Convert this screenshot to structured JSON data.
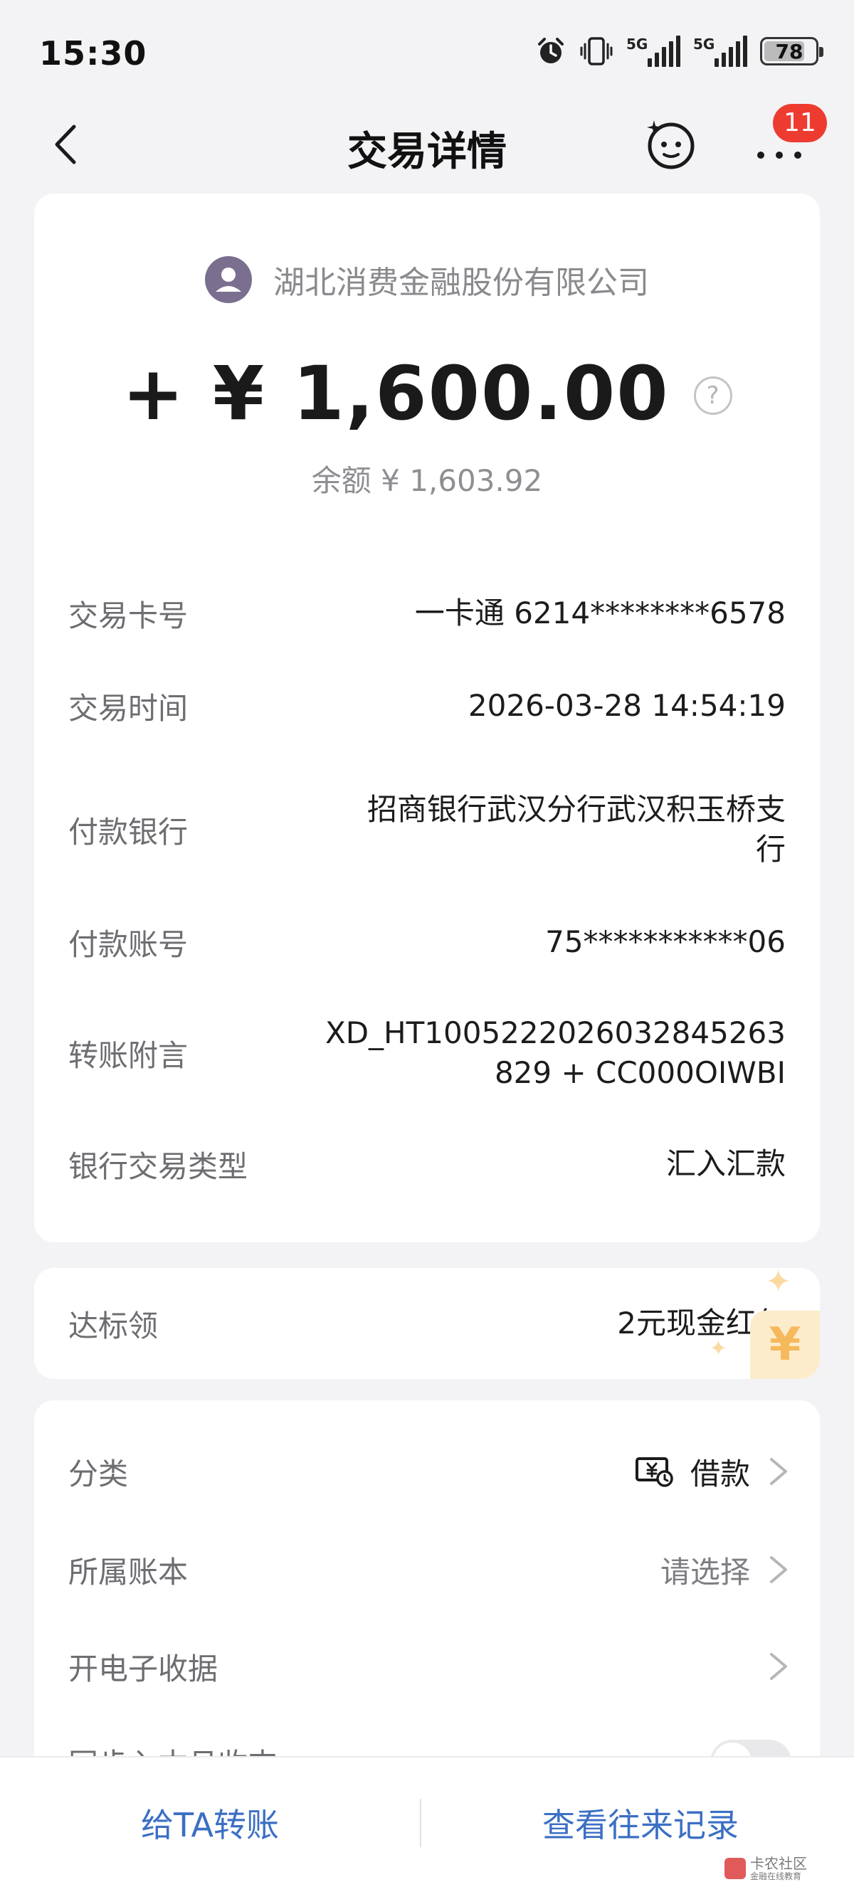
{
  "status_bar": {
    "time": "15:30",
    "network_1": "5G",
    "network_2": "5G",
    "battery": "78",
    "battery_level": 0.78
  },
  "header": {
    "title": "交易详情",
    "notification_count": "11"
  },
  "transaction": {
    "merchant": "湖北消费金融股份有限公司",
    "amount": "+ ¥ 1,600.00",
    "balance": "余额 ¥ 1,603.92",
    "details": [
      {
        "label": "交易卡号",
        "value": "一卡通 6214********6578"
      },
      {
        "label": "交易时间",
        "value": "2026-03-28 14:54:19"
      },
      {
        "label": "付款银行",
        "value_line1": "招商银行武汉分行武汉积玉桥支",
        "value_line2": "行"
      },
      {
        "label": "付款账号",
        "value": "75***********06"
      },
      {
        "label": "转账附言",
        "value_line1": "XD_HT100522202603284526​3",
        "value_line2": "829 + CC000OIWBI"
      },
      {
        "label": "银行交易类型",
        "value": "汇入汇款"
      }
    ]
  },
  "promo": {
    "label": "达标领",
    "value": "2元现金红包",
    "glyph": "¥"
  },
  "settings": {
    "category": {
      "label": "分类",
      "value": "借款"
    },
    "ledger": {
      "label": "所属账本",
      "value": "请选择"
    },
    "receipt": {
      "label": "开电子收据"
    },
    "partial_label": "同步入本月收支"
  },
  "bottom_bar": {
    "transfer": "给TA转账",
    "history": "查看往来记录"
  },
  "watermark": {
    "line1": "卡农社区",
    "line2": "金融在线教育"
  },
  "colors": {
    "accent_blue": "#3b6fc4",
    "badge_red": "#ee3b30",
    "background": "#f3f3f5"
  }
}
